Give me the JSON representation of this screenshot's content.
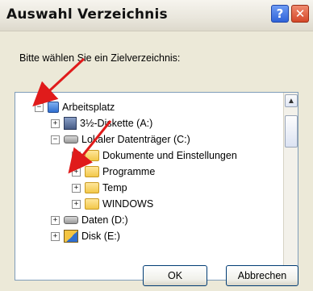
{
  "window": {
    "title": "Auswahl Verzeichnis",
    "help_glyph": "?",
    "close_glyph": "✕"
  },
  "prompt": "Bitte wählen Sie ein Zielverzeichnis:",
  "tree": {
    "items": [
      {
        "label": "Arbeitsplatz",
        "icon": "computer-icon",
        "expander": "−"
      },
      {
        "label": "3½-Diskette (A:)",
        "icon": "floppy-drive-icon",
        "expander": "+"
      },
      {
        "label": "Lokaler Datenträger (C:)",
        "icon": "hard-drive-icon",
        "expander": "−"
      },
      {
        "label": "Dokumente und Einstellungen",
        "icon": "folder-icon",
        "expander": "+"
      },
      {
        "label": "Programme",
        "icon": "folder-icon",
        "expander": "+"
      },
      {
        "label": "Temp",
        "icon": "folder-icon",
        "expander": "+"
      },
      {
        "label": "WINDOWS",
        "icon": "folder-icon",
        "expander": "+"
      },
      {
        "label": "Daten (D:)",
        "icon": "hard-drive-icon",
        "expander": "+"
      },
      {
        "label": "Disk (E:)",
        "icon": "removable-disk-icon",
        "expander": "+"
      }
    ]
  },
  "scrollbar": {
    "up": "▲",
    "down": "▼"
  },
  "buttons": {
    "ok": "OK",
    "cancel": "Abbrechen"
  },
  "colors": {
    "annotation_arrow": "#e01b1b",
    "titlebar": "#ece9d8",
    "selection_border": "#7f9db9"
  }
}
